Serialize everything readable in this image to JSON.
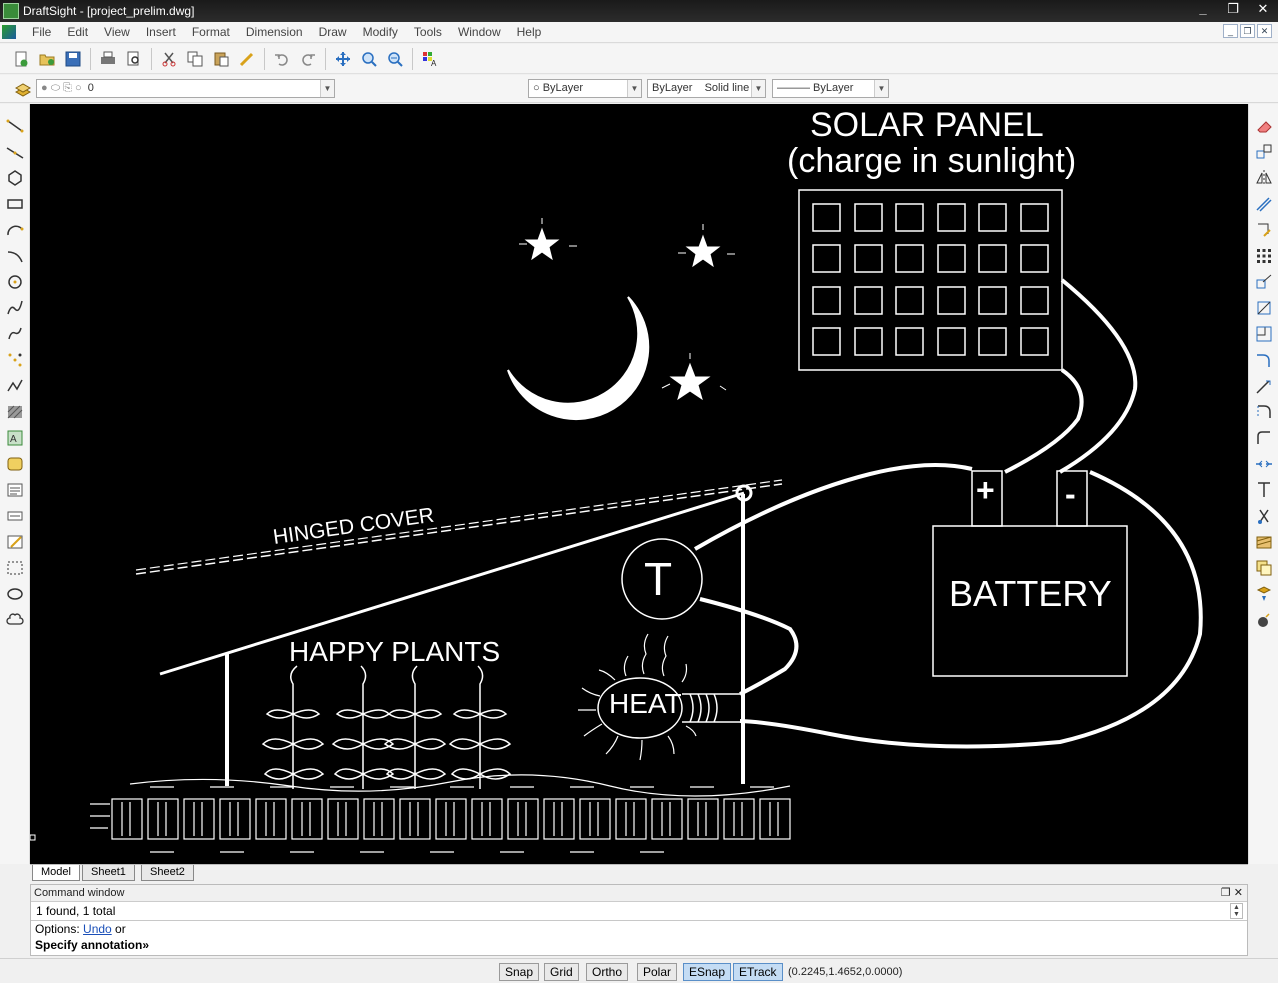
{
  "window": {
    "title": "DraftSight - [project_prelim.dwg]",
    "controls": [
      "_",
      "❐",
      "✕"
    ]
  },
  "menu": {
    "items": [
      "File",
      "Edit",
      "View",
      "Insert",
      "Format",
      "Dimension",
      "Draw",
      "Modify",
      "Tools",
      "Window",
      "Help"
    ],
    "mdi_controls": [
      "_",
      "❐",
      "✕"
    ]
  },
  "properties": {
    "layer_value": "0",
    "color_value": "ByLayer",
    "linestyle_value": "ByLayer",
    "linestyle_name": "Solid line",
    "lineweight_value": "——— ByLayer"
  },
  "drawing": {
    "title_line1": "SOLAR PANEL",
    "title_line2": "(charge in sunlight)",
    "battery_label": "BATTERY",
    "plus_label": "+",
    "minus_label": "-",
    "thermostat_label": "T",
    "heat_label": "HEAT",
    "plants_label": "HAPPY PLANTS",
    "cover_label": "HINGED COVER"
  },
  "sheets": {
    "tabs": [
      "Model",
      "Sheet1",
      "Sheet2"
    ],
    "active": "Model"
  },
  "command": {
    "header": "Command window",
    "header_controls": "❐ ✕",
    "output": "1 found, 1 total",
    "options_prefix": "Options: ",
    "options_link": "Undo",
    "options_suffix": " or",
    "prompt": "Specify annotation»"
  },
  "status": {
    "buttons": [
      {
        "label": "Snap",
        "on": false
      },
      {
        "label": "Grid",
        "on": false
      },
      {
        "label": "Ortho",
        "on": false
      },
      {
        "label": "Polar",
        "on": false
      },
      {
        "label": "ESnap",
        "on": true
      },
      {
        "label": "ETrack",
        "on": true
      }
    ],
    "coordinates": "(0.2245,1.4652,0.0000)"
  },
  "colors": {
    "canvas_bg": "#000000",
    "drawing_stroke": "#ffffff",
    "status_active": "#c4dcf4"
  }
}
